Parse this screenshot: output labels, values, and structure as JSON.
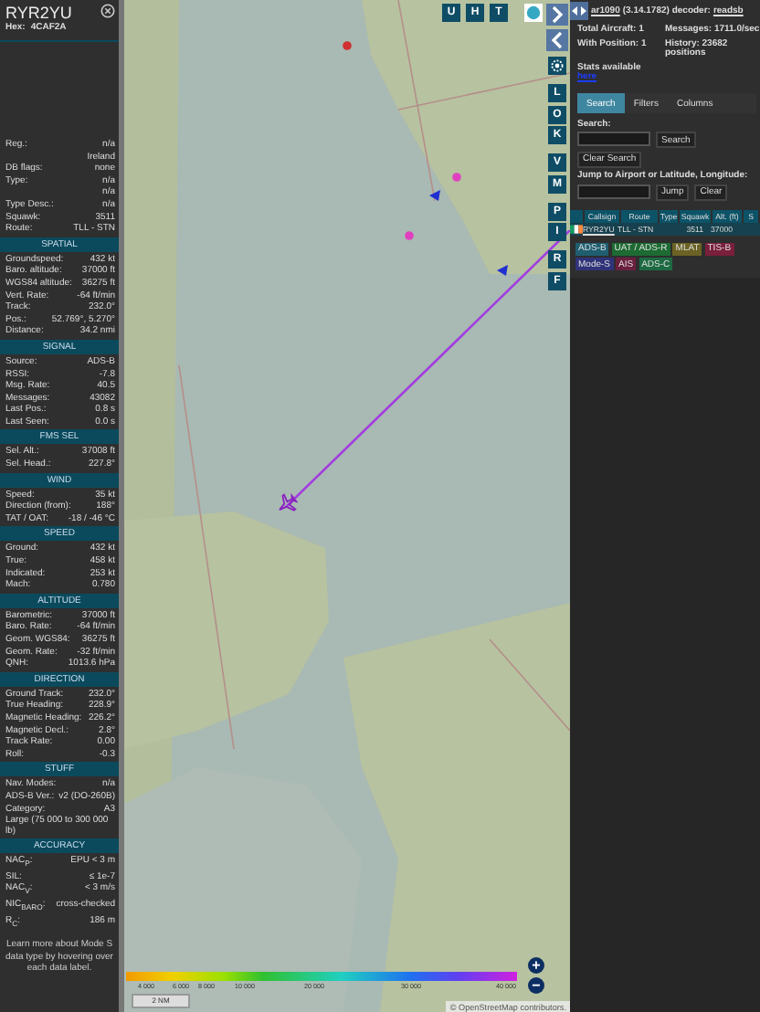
{
  "aircraft_panel": {
    "callsign": "RYR2YU",
    "hex_label": "Hex:",
    "hex": "4CAF2A",
    "info_rows": [
      {
        "label": "Reg.:",
        "value": "n/a"
      },
      {
        "value": "Ireland"
      },
      {
        "label": "DB flags:",
        "value": "none"
      },
      {
        "label": "Type:",
        "value": "n/a"
      },
      {
        "value": "n/a"
      },
      {
        "label": "Type Desc.:",
        "value": "n/a"
      },
      {
        "label": "Squawk:",
        "value": "3511"
      },
      {
        "label": "Route:",
        "value": "TLL - STN"
      }
    ],
    "sections": [
      {
        "title": "SPATIAL",
        "rows": [
          {
            "label": "Groundspeed:",
            "value": "432 kt"
          },
          {
            "label": "Baro. altitude:",
            "value": "37000 ft"
          },
          {
            "label": "WGS84 altitude:",
            "value": "36275 ft"
          },
          {
            "label": "Vert. Rate:",
            "value": "-64 ft/min"
          },
          {
            "label": "Track:",
            "value": "232.0°"
          },
          {
            "label": "Pos.:",
            "value": "52.769°, 5.270°"
          },
          {
            "label": "Distance:",
            "value": "34.2 nmi"
          }
        ]
      },
      {
        "title": "SIGNAL",
        "rows": [
          {
            "label": "Source:",
            "value": "ADS-B"
          },
          {
            "label": "RSSI:",
            "value": "-7.8"
          },
          {
            "label": "Msg. Rate:",
            "value": "40.5"
          },
          {
            "label": "Messages:",
            "value": "43082"
          },
          {
            "label": "Last Pos.:",
            "value": "0.8 s"
          },
          {
            "label": "Last Seen:",
            "value": "0.0 s"
          }
        ]
      },
      {
        "title": "FMS SEL",
        "rows": [
          {
            "label": "Sel. Alt.:",
            "value": "37008 ft"
          },
          {
            "label": "Sel. Head.:",
            "value": "227.8°"
          }
        ]
      },
      {
        "title": "WIND",
        "rows": [
          {
            "label": "Speed:",
            "value": "35 kt"
          },
          {
            "label": "Direction (from):",
            "value": "188°"
          },
          {
            "label": "TAT / OAT:",
            "value": "-18 / -46 °C"
          }
        ]
      },
      {
        "title": "SPEED",
        "rows": [
          {
            "label": "Ground:",
            "value": "432 kt"
          },
          {
            "label": "True:",
            "value": "458 kt"
          },
          {
            "label": "Indicated:",
            "value": "253 kt"
          },
          {
            "label": "Mach:",
            "value": "0.780"
          }
        ]
      },
      {
        "title": "ALTITUDE",
        "rows": [
          {
            "label": "Barometric:",
            "value": "37000 ft"
          },
          {
            "label": "Baro. Rate:",
            "value": "-64 ft/min"
          },
          {
            "label": "Geom. WGS84:",
            "value": "36275 ft"
          },
          {
            "label": "Geom. Rate:",
            "value": "-32 ft/min"
          },
          {
            "label": "QNH:",
            "value": "1013.6 hPa"
          }
        ]
      },
      {
        "title": "DIRECTION",
        "rows": [
          {
            "label": "Ground Track:",
            "value": "232.0°"
          },
          {
            "label": "True Heading:",
            "value": "228.9°"
          },
          {
            "label": "Magnetic Heading:",
            "value": "226.2°"
          },
          {
            "label": "Magnetic Decl.:",
            "value": "2.8°"
          },
          {
            "label": "Track Rate:",
            "value": "0.00"
          },
          {
            "label": "Roll:",
            "value": "-0.3"
          }
        ]
      },
      {
        "title": "STUFF",
        "rows": [
          {
            "label": "Nav. Modes:",
            "value": "n/a"
          },
          {
            "label": "ADS-B Ver.:",
            "value": "v2 (DO-260B)"
          },
          {
            "label": "Category:",
            "value": "A3"
          }
        ],
        "note": "Large (75 000 to 300 000 lb)"
      },
      {
        "title": "ACCURACY",
        "rows": [
          {
            "label": "NAC$_{P}$:",
            "value": "EPU < 3 m"
          },
          {
            "label": "SIL:",
            "value": "≤ 1e-7"
          },
          {
            "label": "NAC$_{V}$:",
            "value": "< 3 m/s"
          },
          {
            "label": "NIC$_{BARO}$:",
            "value": "cross-checked"
          },
          {
            "label": "R$_{C}$:",
            "value": "186 m"
          }
        ]
      }
    ],
    "footer": "Learn more about Mode S data type by hovering over each data label."
  },
  "map": {
    "top_buttons": [
      "U",
      "H",
      "T"
    ],
    "side_groups": [
      [
        "L",
        "O",
        "K"
      ],
      [
        "V",
        "M"
      ],
      [
        "P",
        "I"
      ],
      [
        "R",
        "F"
      ]
    ],
    "altitude_legend": [
      "4 000",
      "6 000",
      "8 000",
      "10 000",
      "20 000",
      "30 000",
      "40 000"
    ],
    "scale": "2 NM",
    "zoom_in": "+",
    "zoom_out": "−",
    "attribution": {
      "prefix": "©",
      "link": "OpenStreetMap",
      "suffix": "contributors."
    }
  },
  "side_panel": {
    "app_link": "ar1090",
    "version": "(3.14.1782) decoder:",
    "decoder_link": "readsb",
    "stats": [
      "Total Aircraft: 1",
      "Messages: 1711.0/sec",
      "With Position: 1",
      "History: 23682 positions"
    ],
    "stats_text": "Stats available",
    "stats_link": "here",
    "tabs": [
      {
        "label": "Search",
        "selected": true
      },
      {
        "label": "Filters",
        "selected": false
      },
      {
        "label": "Columns",
        "selected": false
      }
    ],
    "search_label": "Search:",
    "search_button": "Search",
    "clear_search_button": "Clear Search",
    "jump_label": "Jump to Airport or Latitude, Longitude:",
    "jump_button": "Jump",
    "clear_button": "Clear",
    "columns": [
      "Callsign",
      "Route",
      "Type",
      "Squawk",
      "Alt. (ft)",
      "S"
    ],
    "rows": [
      {
        "selected": true,
        "callsign": "RYR2YU",
        "route": "TLL - STN",
        "squawk": "3511",
        "altitude": "37000"
      }
    ],
    "legend": [
      {
        "label": "ADS-B",
        "color": "#1f5e70"
      },
      {
        "label": "UAT / ADS-R",
        "color": "#1d6b33"
      },
      {
        "label": "MLAT",
        "color": "#6b6224"
      },
      {
        "label": "TIS-B",
        "color": "#7a1f3c"
      },
      {
        "label": "Mode-S",
        "color": "#30337a"
      },
      {
        "label": "AIS",
        "color": "#6a1f3e"
      },
      {
        "label": "ADS-C",
        "color": "#1d6a42"
      }
    ]
  }
}
